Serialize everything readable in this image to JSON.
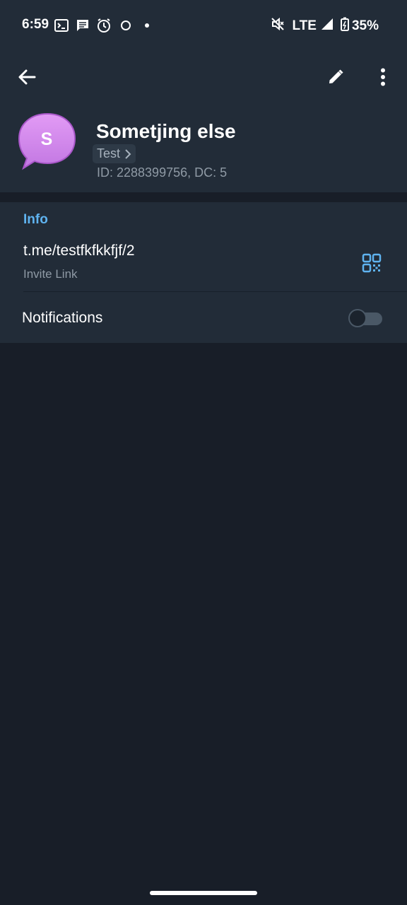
{
  "status_bar": {
    "time": "6:59",
    "network": "LTE",
    "battery": "35%",
    "left_icons": [
      "terminal-icon",
      "message-icon",
      "alarm-icon",
      "circle-icon",
      "dot-icon"
    ],
    "right_icons": [
      "mute-icon",
      "signal-icon",
      "battery-charging-icon"
    ]
  },
  "toolbar": {
    "back_icon": "arrow-left-icon",
    "edit_icon": "pencil-icon",
    "more_icon": "more-vertical-icon"
  },
  "profile": {
    "avatar_letter": "S",
    "avatar_color": "#c77be8",
    "name": "Sometjing else",
    "folder": "Test",
    "id_line": "ID: 2288399756, DC: 5"
  },
  "info": {
    "section_title": "Info",
    "link_value": "t.me/testfkfkkfjf/2",
    "link_caption": "Invite Link",
    "qr_icon": "qr-code-icon"
  },
  "notifications": {
    "label": "Notifications",
    "enabled": false
  },
  "colors": {
    "header_bg": "#222c38",
    "page_bg": "#181e28",
    "accent": "#5fb3f0"
  }
}
